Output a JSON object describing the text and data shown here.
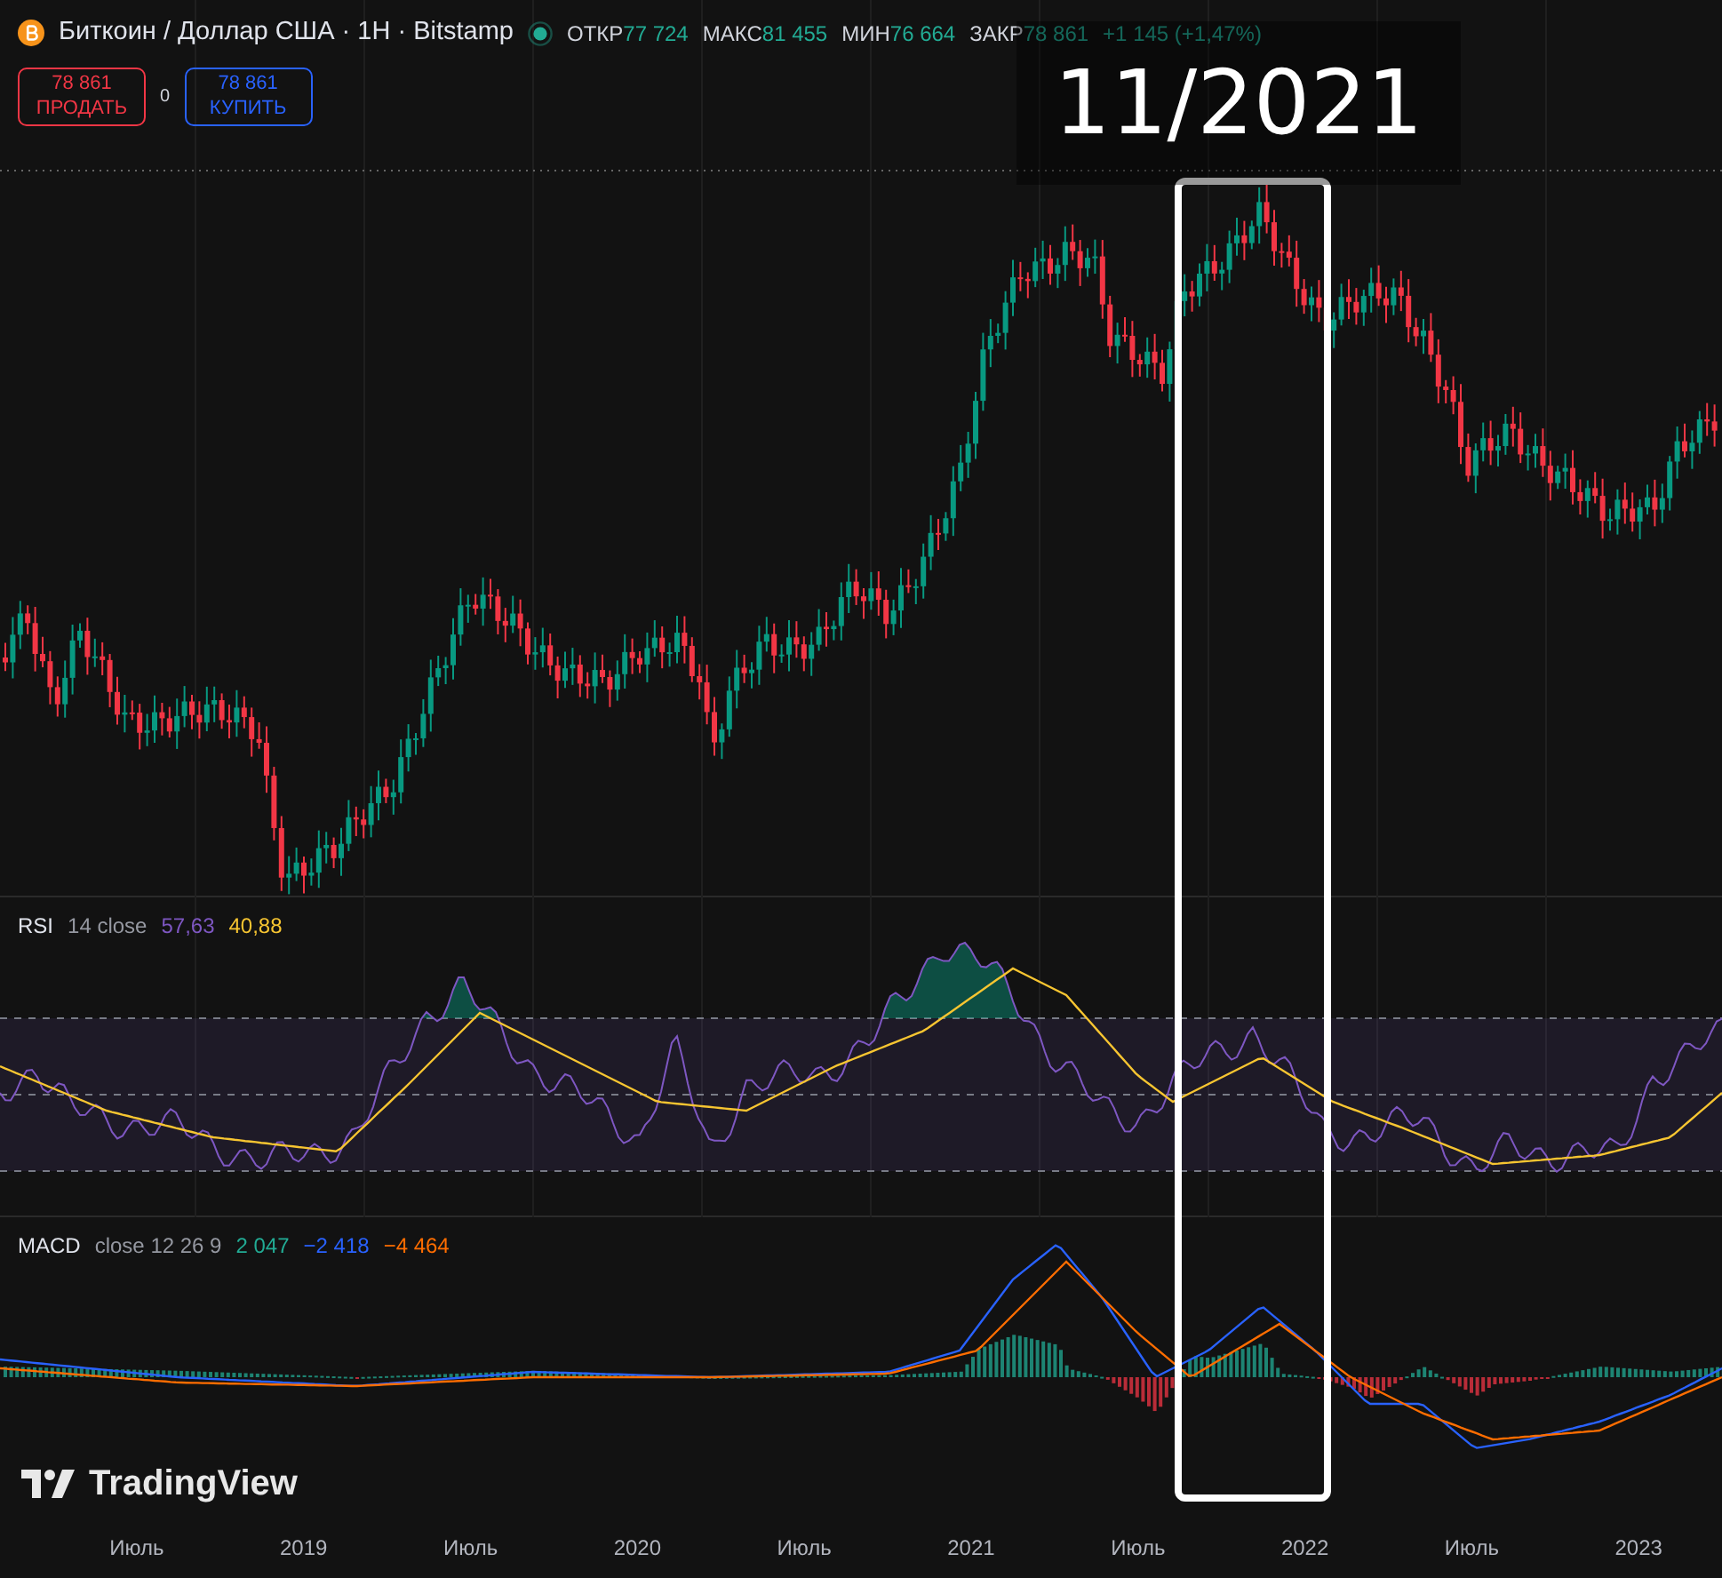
{
  "symbol": {
    "title": "Биткоин / Доллар США · 1H · Bitstamp",
    "market_open": true
  },
  "ohlc": [
    {
      "label": "ОТКР",
      "value": "77 724"
    },
    {
      "label": "МАКС",
      "value": "81 455"
    },
    {
      "label": "МИН",
      "value": "76 664"
    },
    {
      "label": "ЗАКР",
      "value": "78 861"
    }
  ],
  "change": "+1 145 (+1,47%)",
  "trade": {
    "sell": {
      "price": "78 861",
      "label": "ПРОДАТЬ"
    },
    "spread": "0",
    "buy": {
      "price": "78 861",
      "label": "КУПИТЬ"
    }
  },
  "indicators": [
    {
      "kind": "rsi",
      "name": "RSI",
      "params": "14 close",
      "values": [
        {
          "text": "57,63",
          "color": "#7e57c2"
        },
        {
          "text": "40,88",
          "color": "#f7c531"
        }
      ]
    },
    {
      "kind": "macd",
      "name": "MACD",
      "params": "close 12 26 9",
      "values": [
        {
          "text": "2 047",
          "color": "#22ab94"
        },
        {
          "text": "−2 418",
          "color": "#2962ff"
        },
        {
          "text": "−4 464",
          "color": "#ff6d00"
        }
      ]
    }
  ],
  "annotation": {
    "label": "11/2021"
  },
  "logo": "TradingView",
  "x_axis": [
    "Июль",
    "2019",
    "Июль",
    "2020",
    "Июль",
    "2021",
    "Июль",
    "2022",
    "Июль",
    "2023"
  ]
}
